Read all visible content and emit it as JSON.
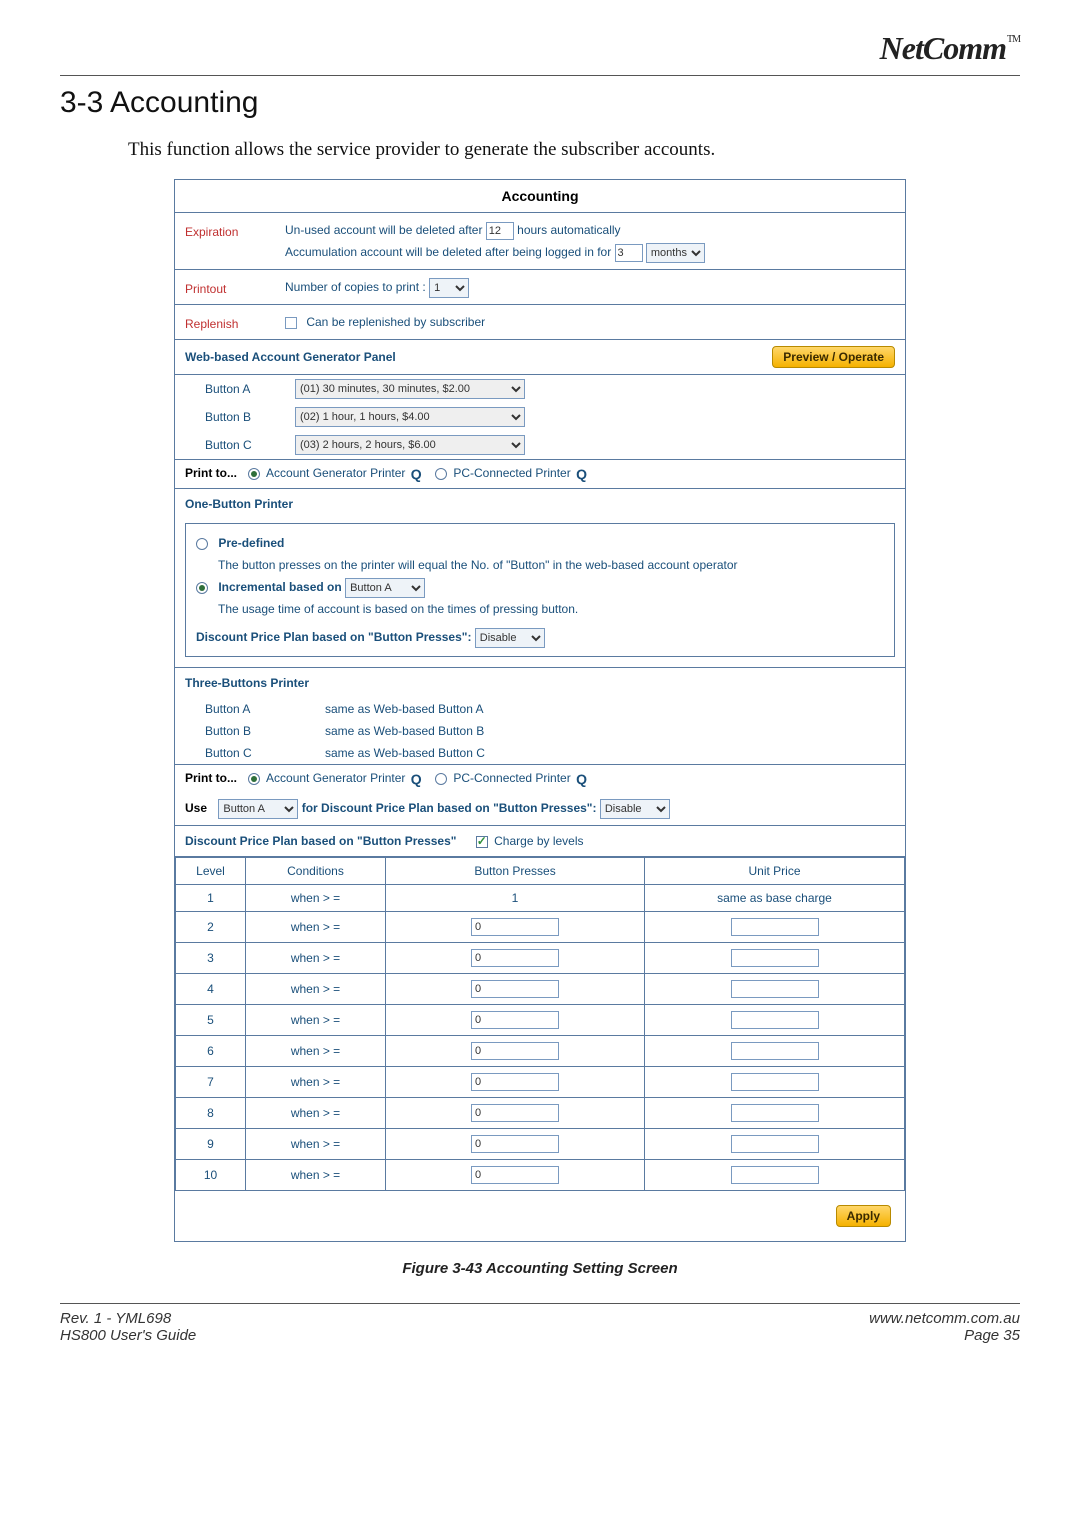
{
  "brand": {
    "name": "NetComm",
    "tm": "TM"
  },
  "section": {
    "number_title": "3-3  Accounting"
  },
  "intro": "This function allows the service provider to generate the subscriber accounts.",
  "panel": {
    "title": "Accounting",
    "expiration": {
      "label": "Expiration",
      "line1a": "Un-used account will be deleted after",
      "line1_value": "12",
      "line1b": "hours automatically",
      "line2a": "Accumulation account will be deleted after being logged in for",
      "line2_value": "3",
      "line2_unit": "months"
    },
    "printout": {
      "label": "Printout",
      "text": "Number of copies to print :",
      "value": "1"
    },
    "replenish": {
      "label": "Replenish",
      "text": "Can be replenished by subscriber"
    },
    "webgen": {
      "title": "Web-based Account Generator Panel",
      "preview_btn": "Preview / Operate",
      "buttons": [
        {
          "name": "Button A",
          "option": "(01) 30 minutes, 30 minutes, $2.00"
        },
        {
          "name": "Button B",
          "option": "(02) 1 hour, 1 hours, $4.00"
        },
        {
          "name": "Button C",
          "option": "(03) 2 hours, 2 hours, $6.00"
        }
      ],
      "print_to_label": "Print to...",
      "radio1": "Account Generator Printer",
      "radio2": "PC-Connected Printer"
    },
    "onebutton": {
      "title": "One-Button Printer",
      "predefined_label": "Pre-defined",
      "predefined_text": "The button presses on the printer will equal the No. of \"Button\" in the web-based account operator",
      "incremental_label": "Incremental based on",
      "incremental_value": "Button A",
      "incremental_text": "The usage time of account is based on the times of pressing button.",
      "discount_label": "Discount Price Plan based on \"Button Presses\":",
      "discount_value": "Disable"
    },
    "threebuttons": {
      "title": "Three-Buttons Printer",
      "rows": [
        {
          "name": "Button A",
          "text": "same as Web-based Button A"
        },
        {
          "name": "Button B",
          "text": "same as Web-based Button B"
        },
        {
          "name": "Button C",
          "text": "same as Web-based Button C"
        }
      ],
      "print_to_label": "Print to...",
      "radio1": "Account Generator Printer",
      "radio2": "PC-Connected Printer",
      "use_label": "Use",
      "use_value": "Button A",
      "use_text": "for Discount Price Plan based on \"Button Presses\":",
      "use_disable": "Disable"
    },
    "discount": {
      "title": "Discount Price Plan based on \"Button Presses\"",
      "charge_label": "Charge by levels",
      "headers": [
        "Level",
        "Conditions",
        "Button Presses",
        "Unit Price"
      ],
      "first_row": {
        "level": "1",
        "cond": "when > =",
        "presses": "1",
        "price": "same as base charge"
      },
      "rows": [
        {
          "level": "2",
          "cond": "when > =",
          "presses": "0",
          "price": ""
        },
        {
          "level": "3",
          "cond": "when > =",
          "presses": "0",
          "price": ""
        },
        {
          "level": "4",
          "cond": "when > =",
          "presses": "0",
          "price": ""
        },
        {
          "level": "5",
          "cond": "when > =",
          "presses": "0",
          "price": ""
        },
        {
          "level": "6",
          "cond": "when > =",
          "presses": "0",
          "price": ""
        },
        {
          "level": "7",
          "cond": "when > =",
          "presses": "0",
          "price": ""
        },
        {
          "level": "8",
          "cond": "when > =",
          "presses": "0",
          "price": ""
        },
        {
          "level": "9",
          "cond": "when > =",
          "presses": "0",
          "price": ""
        },
        {
          "level": "10",
          "cond": "when > =",
          "presses": "0",
          "price": ""
        }
      ]
    },
    "apply_btn": "Apply"
  },
  "figure_caption": "Figure 3-43 Accounting Setting Screen",
  "footer": {
    "left1": "Rev. 1 - YML698",
    "left2": "HS800 User's Guide",
    "right1": "www.netcomm.com.au",
    "right2": "Page 35"
  }
}
